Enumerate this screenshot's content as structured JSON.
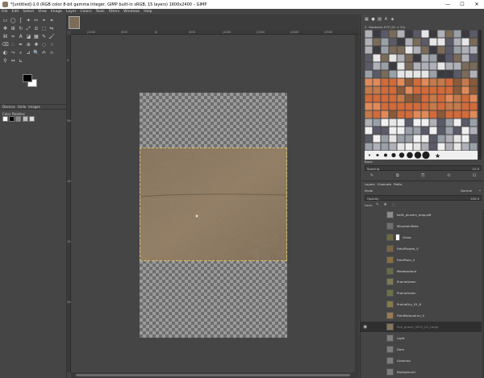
{
  "window": {
    "title": "*[untitled]-1.0 (RGB color 8-bit gamma integer, GIMP built-in sRGB, 15 layers) 1600x2400 – GIMP",
    "minimize": "—",
    "maximize": "☐",
    "close": "✕"
  },
  "menu": [
    "File",
    "Edit",
    "Select",
    "View",
    "Image",
    "Layer",
    "Colors",
    "Tools",
    "Filters",
    "Windows",
    "Help"
  ],
  "toolbox": {
    "tabs": [
      "Devices",
      "Undo",
      "Images"
    ],
    "tool_options_title": "Color Palettes",
    "icon_rows": [
      [
        "rect-select-icon",
        "ellipse-select-icon",
        "lasso-icon",
        "fuzzy-select-icon",
        "scissors-icon",
        "foreground-select-icon",
        "crop-icon"
      ],
      [
        "move-icon",
        "align-icon",
        "rotate-icon",
        "scale-icon",
        "shear-icon",
        "perspective-icon",
        "flip-icon"
      ],
      [
        "cage-icon",
        "warp-icon",
        "text-icon",
        "bucket-fill-icon",
        "gradient-icon",
        "pencil-icon",
        "paintbrush-icon"
      ],
      [
        "eraser-icon",
        "airbrush-icon",
        "ink-icon",
        "clone-icon",
        "heal-icon",
        "blur-icon",
        "smudge-icon"
      ],
      [
        "dodge-icon",
        "path-icon",
        "color-picker-icon",
        "measure-icon",
        "zoom-icon",
        "mypaint-icon",
        "handle-icon"
      ],
      [
        "eyedropper-icon",
        "paths-icon",
        "measure-tool-icon"
      ]
    ],
    "icon_glyphs": [
      [
        "▭",
        "◯",
        "ʃ",
        "✦",
        "✂",
        "⌖",
        "⌗"
      ],
      [
        "✥",
        "⊞",
        "↻",
        "⤢",
        "⧄",
        "⬚",
        "⇋"
      ],
      [
        "⌘",
        "≈",
        "A",
        "◪",
        "▦",
        "✎",
        "🖌"
      ],
      [
        "⌫",
        "∴",
        "✒",
        "⊕",
        "✚",
        "◌",
        "☝"
      ],
      [
        "◐",
        "⤳",
        "⌕",
        "⊿",
        "🔍",
        "✍",
        "⊹"
      ],
      [
        "⚲",
        "↭",
        "⊾"
      ]
    ],
    "fg_color": "#000000",
    "bg_color": "#ffffff",
    "gradient_presets": [
      "#ffffff",
      "#000000",
      "#888888",
      "#bbbbbb",
      "#dddddd"
    ]
  },
  "rulers": {
    "horizontal": [
      "|1000",
      "|500",
      "|0",
      "|500",
      "|1000",
      "|1500",
      "|2000",
      "|2500"
    ],
    "vertical": [
      "0",
      "500",
      "1000",
      "1500",
      "2000"
    ]
  },
  "canvas": {
    "image_tab_color": "#7d6d58",
    "texture_base": "#8a7458"
  },
  "brushes": {
    "tab_icons": [
      "▦",
      "●",
      "▨",
      "A",
      "◈"
    ],
    "current": "2. Hardness 075 (51 × 51)",
    "tag_filter": "Basic",
    "spacing_label": "Spacing",
    "spacing_value": "10.0",
    "actions": [
      "✎",
      "⧉",
      "⎘",
      "⟲",
      "⊡"
    ],
    "palette": [
      "#5a5a68",
      "#7a6a5a",
      "#b0b0b8",
      "#d26a3a",
      "#e08a5a",
      "#3a3a40",
      "#9aa0a8",
      "#c47a4a",
      "#e6e6e6",
      "#8a5a3a",
      "#1e1e1e",
      "#f0f0f0"
    ]
  },
  "layers_panel": {
    "tabs": [
      "Layers",
      "Channels",
      "Paths"
    ],
    "mode_label": "Mode",
    "mode_value": "Normal",
    "opacity_label": "Opacity",
    "opacity_value": "100.0",
    "lock_label": "Lock:",
    "lock_icons": [
      "✎",
      "✥",
      "⬚"
    ],
    "layers": [
      {
        "name": "heXt_pluvers_map.pdf",
        "thumb": "#8c8c8c",
        "mask": false,
        "visible": false,
        "active": false
      },
      {
        "name": "MountainRoks",
        "thumb": "#6f6f6f",
        "mask": false,
        "visible": false,
        "active": false
      },
      {
        "name": "Grass",
        "thumb": "#6b6a3e",
        "mask": true,
        "visible": false,
        "active": false
      },
      {
        "name": "FieldPlowed_V",
        "thumb": "#7a6540",
        "mask": false,
        "visible": false,
        "active": false
      },
      {
        "name": "FieldPlain_V",
        "thumb": "#8a6e3e",
        "mask": false,
        "visible": false,
        "active": false
      },
      {
        "name": "Meadowland",
        "thumb": "#6a6a48",
        "mask": false,
        "visible": false,
        "active": false
      },
      {
        "name": "PrairieGreen",
        "thumb": "#7d7a52",
        "mask": false,
        "visible": false,
        "active": false
      },
      {
        "name": "PrairieGreen",
        "thumb": "#6e7148",
        "mask": false,
        "visible": false,
        "active": false
      },
      {
        "name": "PrairieDry_01_H",
        "thumb": "#8a7a4a",
        "mask": false,
        "visible": false,
        "active": false
      },
      {
        "name": "FieldMuturalrun_V",
        "thumb": "#9a7a50",
        "mask": false,
        "visible": false,
        "active": false
      },
      {
        "name": "Soil_gravel_0001_00_Large",
        "thumb": "#8a7458",
        "mask": false,
        "visible": true,
        "active": true
      },
      {
        "name": "Light",
        "thumb": "#7d7d7d",
        "mask": false,
        "visible": false,
        "active": false
      },
      {
        "name": "Dark",
        "thumb": "#7d7d7d",
        "mask": false,
        "visible": false,
        "active": false
      },
      {
        "name": "Greenish",
        "thumb": "#7d7d7d",
        "mask": false,
        "visible": false,
        "active": false
      },
      {
        "name": "Background",
        "thumb": "#7d7d7d",
        "mask": false,
        "visible": false,
        "active": false
      }
    ]
  }
}
